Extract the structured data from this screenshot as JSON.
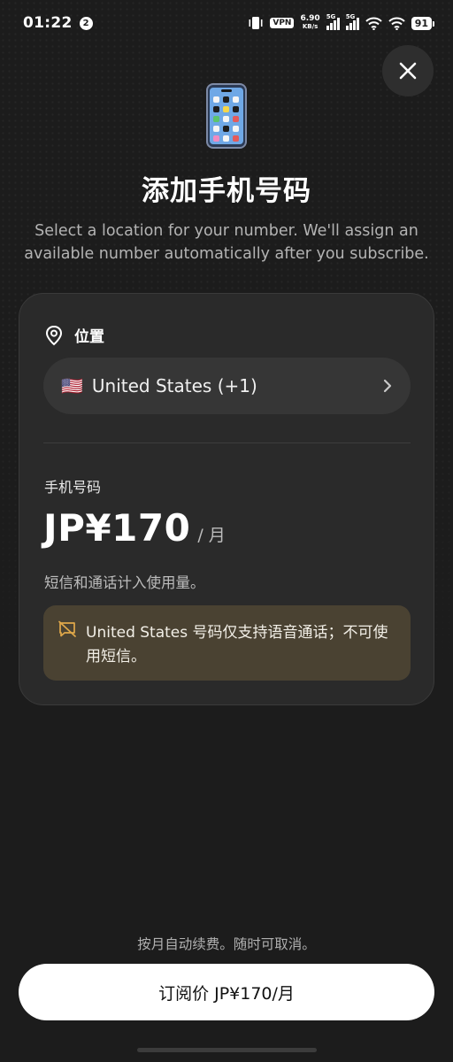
{
  "status_bar": {
    "time": "01:22",
    "notification_count": "2",
    "vpn": "VPN",
    "speed_value": "6.90",
    "speed_unit": "KB/s",
    "sim1_type": "5G",
    "sim2_type": "5G",
    "battery": "91"
  },
  "header": {
    "title": "添加手机号码",
    "subtitle": "Select a location for your number. We'll assign an available number automatically after you subscribe."
  },
  "location": {
    "label": "位置",
    "flag": "🇺🇸",
    "selected": "United States (+1)"
  },
  "number": {
    "label": "手机号码",
    "price": "JP¥170",
    "period": "/ 月",
    "usage_note": "短信和通话计入使用量。",
    "warning": "United States 号码仅支持语音通话；不可使用短信。"
  },
  "footer": {
    "renew_note": "按月自动续费。随时可取消。",
    "subscribe_label": "订阅价 JP¥170/月"
  },
  "colors": {
    "background": "#1c1c1c",
    "card": "#2a2a2a",
    "warning_bg": "#4a4232",
    "warning_icon": "#e0a84a",
    "button_bg": "#ffffff"
  },
  "icons": [
    "close-icon",
    "phone-icon",
    "location-pin-icon",
    "chevron-right-icon",
    "sms-disabled-icon"
  ]
}
